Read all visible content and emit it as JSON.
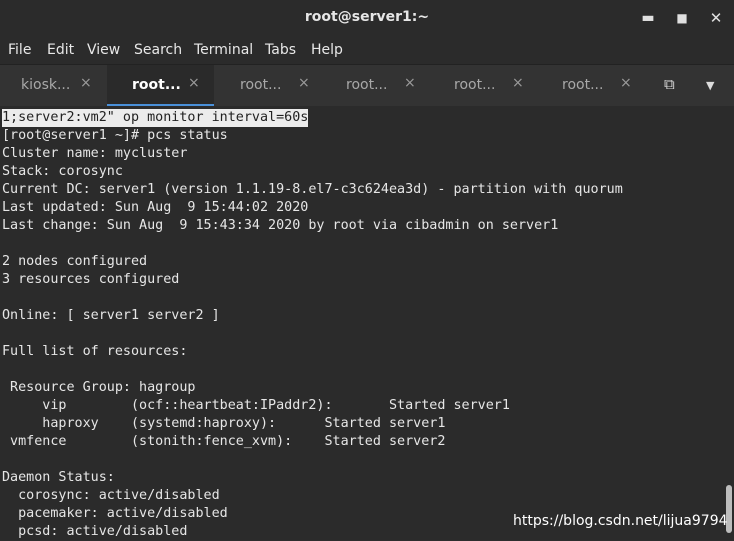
{
  "window": {
    "title": "root@server1:~",
    "minimize_icon": "minimize-icon",
    "maximize_icon": "maximize-icon",
    "close_icon": "close-icon"
  },
  "menu": [
    "File",
    "Edit",
    "View",
    "Search",
    "Terminal",
    "Tabs",
    "Help"
  ],
  "tabs": [
    {
      "label": "kiosk...",
      "active": false
    },
    {
      "label": "root...",
      "active": true
    },
    {
      "label": "root...",
      "active": false
    },
    {
      "label": "root...",
      "active": false
    },
    {
      "label": "root...",
      "active": false
    },
    {
      "label": "root...",
      "active": false
    }
  ],
  "tab_close_glyph": "×",
  "tab_actions": {
    "new_tab_icon": "new-tab-icon",
    "menu_icon": "chevron-down-icon"
  },
  "terminal": {
    "lines": [
      "1;server2:vm2\" op monitor interval=60s",
      "[root@server1 ~]# pcs status",
      "Cluster name: mycluster",
      "Stack: corosync",
      "Current DC: server1 (version 1.1.19-8.el7-c3c624ea3d) - partition with quorum",
      "Last updated: Sun Aug  9 15:44:02 2020",
      "Last change: Sun Aug  9 15:43:34 2020 by root via cibadmin on server1",
      "",
      "2 nodes configured",
      "3 resources configured",
      "",
      "Online: [ server1 server2 ]",
      "",
      "Full list of resources:",
      "",
      " Resource Group: hagroup",
      "     vip        (ocf::heartbeat:IPaddr2):       Started server1",
      "     haproxy    (systemd:haproxy):      Started server1",
      " vmfence        (stonith:fence_xvm):    Started server2",
      "",
      "Daemon Status:",
      "  corosync: active/disabled",
      "  pacemaker: active/disabled",
      "  pcsd: active/disabled"
    ],
    "selected_line_index": 0
  },
  "watermark": "https://blog.csdn.net/lijua9794"
}
